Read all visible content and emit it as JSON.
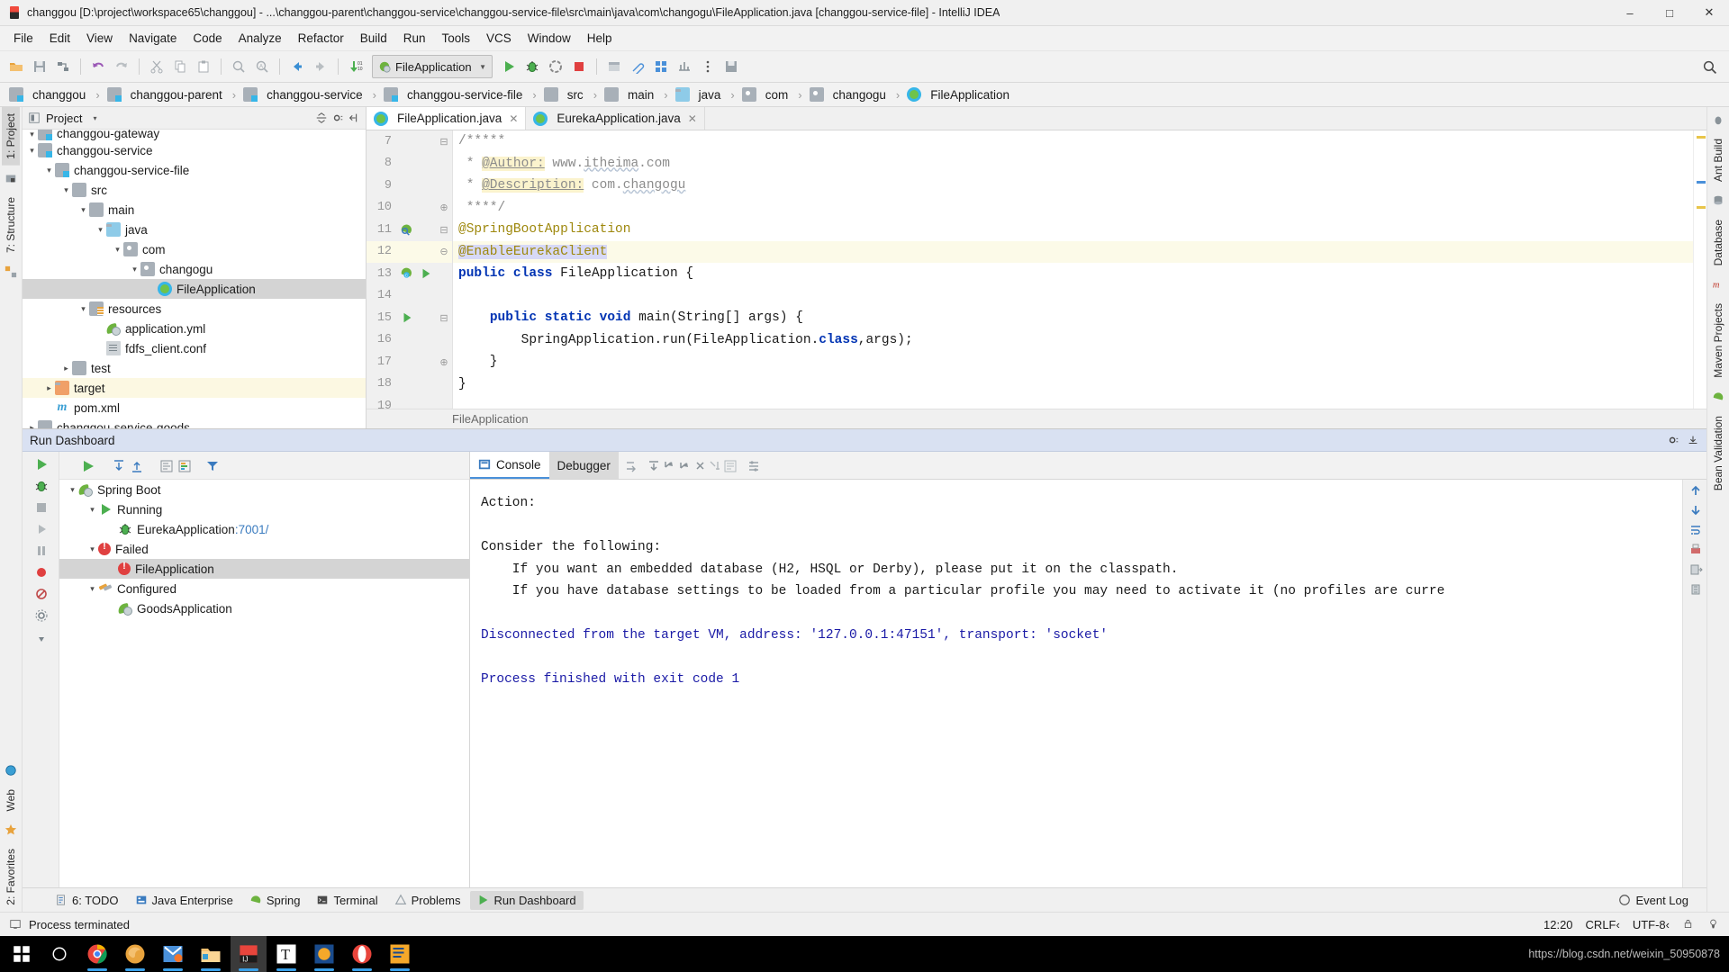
{
  "window": {
    "title": "changgou [D:\\project\\workspace65\\changgou] - ...\\changgou-parent\\changgou-service\\changgou-service-file\\src\\main\\java\\com\\changogu\\FileApplication.java [changgou-service-file] - IntelliJ IDEA",
    "app_icon": "intellij-idea-icon",
    "minimize": "–",
    "maximize": "□",
    "close": "✕"
  },
  "menu": [
    {
      "label": "File"
    },
    {
      "label": "Edit"
    },
    {
      "label": "View"
    },
    {
      "label": "Navigate"
    },
    {
      "label": "Code"
    },
    {
      "label": "Analyze"
    },
    {
      "label": "Refactor"
    },
    {
      "label": "Build"
    },
    {
      "label": "Run"
    },
    {
      "label": "Tools"
    },
    {
      "label": "VCS"
    },
    {
      "label": "Window"
    },
    {
      "label": "Help"
    }
  ],
  "toolbar": {
    "run_config": "FileApplication",
    "icons": [
      "open-folder-icon",
      "save-all-icon",
      "sync-icon",
      "undo-icon",
      "redo-icon",
      "cut-icon",
      "copy-icon",
      "paste-icon",
      "find-icon",
      "replace-icon",
      "back-icon",
      "forward-icon",
      "compile-icon"
    ],
    "right_icons": [
      "run-icon",
      "debug-icon",
      "coverage-icon",
      "stop-icon",
      "build-project-icon",
      "attach-icon",
      "layout-icon",
      "profiler-icon",
      "more-icon",
      "save-icon"
    ],
    "search_icon": "search-everywhere-icon"
  },
  "breadcrumbs": [
    {
      "label": "changgou",
      "icon": "module-icon"
    },
    {
      "label": "changgou-parent",
      "icon": "module-icon"
    },
    {
      "label": "changgou-service",
      "icon": "module-icon"
    },
    {
      "label": "changgou-service-file",
      "icon": "module-icon"
    },
    {
      "label": "src",
      "icon": "folder-icon"
    },
    {
      "label": "main",
      "icon": "folder-icon"
    },
    {
      "label": "java",
      "icon": "source-folder-icon"
    },
    {
      "label": "com",
      "icon": "package-icon"
    },
    {
      "label": "changogu",
      "icon": "package-icon"
    },
    {
      "label": "FileApplication",
      "icon": "class-icon"
    }
  ],
  "left_strip": [
    {
      "label": "1: Project",
      "active": true
    },
    {
      "label": "7: Structure",
      "active": false
    }
  ],
  "left_strip_bottom": [
    {
      "label": "2: Favorites"
    },
    {
      "label": "Web"
    }
  ],
  "right_strip": [
    {
      "label": "Ant Build"
    },
    {
      "label": "Database"
    },
    {
      "label": "Maven Projects"
    },
    {
      "label": "Bean Validation"
    }
  ],
  "project_panel": {
    "title": "Project",
    "caret": "▾",
    "actions": [
      "collapse-all-icon",
      "settings-icon",
      "hide-icon"
    ],
    "tree": [
      {
        "label": "changgou-gateway",
        "depth": 3,
        "twist": "⌄",
        "icon": "module-icon",
        "state": "clipped"
      },
      {
        "label": "changgou-service",
        "depth": 3,
        "twist": "⌄",
        "icon": "module-icon"
      },
      {
        "label": "changgou-service-file",
        "depth": 4,
        "twist": "⌄",
        "icon": "module-icon"
      },
      {
        "label": "src",
        "depth": 5,
        "twist": "⌄",
        "icon": "folder-icon"
      },
      {
        "label": "main",
        "depth": 6,
        "twist": "⌄",
        "icon": "folder-icon"
      },
      {
        "label": "java",
        "depth": 7,
        "twist": "⌄",
        "icon": "source-folder-icon"
      },
      {
        "label": "com",
        "depth": 8,
        "twist": "⌄",
        "icon": "package-icon"
      },
      {
        "label": "changogu",
        "depth": 9,
        "twist": "⌄",
        "icon": "package-icon"
      },
      {
        "label": "FileApplication",
        "depth": 10,
        "twist": "",
        "icon": "class-run-icon",
        "selected": true
      },
      {
        "label": "resources",
        "depth": 6,
        "twist": "⌄",
        "icon": "resources-folder-icon"
      },
      {
        "label": "application.yml",
        "depth": 7,
        "twist": "",
        "icon": "spring-yaml-icon"
      },
      {
        "label": "fdfs_client.conf",
        "depth": 7,
        "twist": "",
        "icon": "conf-file-icon"
      },
      {
        "label": "test",
        "depth": 5,
        "twist": "›",
        "icon": "folder-icon"
      },
      {
        "label": "target",
        "depth": 4,
        "twist": "›",
        "icon": "excluded-folder-icon",
        "highlight": true
      },
      {
        "label": "pom.xml",
        "depth": 4,
        "twist": "",
        "icon": "maven-icon"
      },
      {
        "label": "changgou-service-goods",
        "depth": 3,
        "twist": "›",
        "icon": "module-icon"
      }
    ]
  },
  "editor": {
    "tabs": [
      {
        "label": "FileApplication.java",
        "icon": "class-run-icon",
        "active": true,
        "close": "✕"
      },
      {
        "label": "EurekaApplication.java",
        "icon": "class-run-icon",
        "active": false,
        "close": "✕"
      }
    ],
    "breadcrumb": "FileApplication",
    "lines": [
      {
        "num": 7,
        "gutter": "",
        "fold": "⊟",
        "html": "<span class='cm'>/*****</span>"
      },
      {
        "num": 8,
        "gutter": "",
        "fold": "",
        "html": "<span class='cm'> * </span><span class='cm hl-y tag-underline'>@Author:</span><span class='cm'> www.</span><span class='cm wavy'>itheima</span><span class='cm'>.com</span>"
      },
      {
        "num": 9,
        "gutter": "",
        "fold": "",
        "html": "<span class='cm'> * </span><span class='cm hl-y tag-underline'>@Description:</span><span class='cm'> com.</span><span class='cm wavy'>changogu</span>"
      },
      {
        "num": 10,
        "gutter": "",
        "fold": "⊕",
        "html": "<span class='cm'> ****/</span>"
      },
      {
        "num": 11,
        "gutter": "spring-bean-icon",
        "fold": "⊟",
        "html": "<span class='anno'>@SpringBootApplication</span>"
      },
      {
        "num": 12,
        "gutter": "",
        "fold": "⊖",
        "current": true,
        "html": "<span class='anno hl-b'>@EnableEurekaClient</span>"
      },
      {
        "num": 13,
        "gutter": "spring-class-icon,run-gutter-icon",
        "fold": "",
        "html": "<span class='kw'>public</span> <span class='kw'>class</span> FileApplication {"
      },
      {
        "num": 14,
        "gutter": "",
        "fold": "",
        "html": ""
      },
      {
        "num": 15,
        "gutter": "run-gutter-icon",
        "fold": "⊟",
        "html": "    <span class='kw'>public</span> <span class='kw'>static</span> <span class='kw'>void</span> main(String[] args) {"
      },
      {
        "num": 16,
        "gutter": "",
        "fold": "",
        "html": "        SpringApplication.run(FileApplication.<span class='kw'>class</span>,args);"
      },
      {
        "num": 17,
        "gutter": "",
        "fold": "⊕",
        "html": "    }"
      },
      {
        "num": 18,
        "gutter": "",
        "fold": "",
        "html": "}"
      },
      {
        "num": 19,
        "gutter": "",
        "fold": "",
        "html": ""
      }
    ]
  },
  "run_dashboard": {
    "title": "Run Dashboard",
    "title_actions": [
      "settings-icon",
      "hide-icon"
    ],
    "left_toolbar_icons": [
      "run-icon",
      "expand-all-icon",
      "collapse-all-icon",
      "show-console-icon",
      "show-output-icon",
      "filter-icon"
    ],
    "side_icons": [
      "rerun-icon",
      "debug-icon",
      "stop-icon",
      "resume-icon",
      "pause-icon",
      "breakpoints-icon",
      "mute-breakpoints-icon",
      "settings-icon",
      "pin-icon"
    ],
    "tree": [
      {
        "label": "Spring Boot",
        "depth": 1,
        "twist": "⌄",
        "icon": "spring-icon"
      },
      {
        "label": "Running",
        "depth": 2,
        "twist": "⌄",
        "icon": "run-icon"
      },
      {
        "label": "EurekaApplication",
        "suffix": ":7001/",
        "depth": 3,
        "twist": "",
        "icon": "debug-icon"
      },
      {
        "label": "Failed",
        "depth": 2,
        "twist": "⌄",
        "icon": "error-icon"
      },
      {
        "label": "FileApplication",
        "depth": 3,
        "twist": "",
        "icon": "error-icon",
        "selected": true
      },
      {
        "label": "Configured",
        "depth": 2,
        "twist": "⌄",
        "icon": "wrench-icon"
      },
      {
        "label": "GoodsApplication",
        "depth": 3,
        "twist": "",
        "icon": "spring-icon"
      }
    ],
    "console_tabs": [
      {
        "label": "Console",
        "icon": "console-icon",
        "active": true
      },
      {
        "label": "Debugger",
        "icon": "",
        "active": false
      }
    ],
    "console_tools": [
      "step-over-icon",
      "step-into-icon",
      "force-step-into-icon",
      "step-out-icon",
      "drop-frame-icon",
      "run-to-cursor-icon",
      "evaluate-icon",
      "mute-icon",
      "settings-icon"
    ],
    "console_output": [
      {
        "text": "Action:",
        "color": "black"
      },
      {
        "text": "",
        "color": "black"
      },
      {
        "text": "Consider the following:",
        "color": "black"
      },
      {
        "text": "    If you want an embedded database (H2, HSQL or Derby), please put it on the classpath.",
        "color": "black"
      },
      {
        "text": "    If you have database settings to be loaded from a particular profile you may need to activate it (no profiles are curre",
        "color": "black"
      },
      {
        "text": "",
        "color": "black"
      },
      {
        "text": "Disconnected from the target VM, address: '127.0.0.1:47151', transport: 'socket'",
        "color": "blue"
      },
      {
        "text": "",
        "color": "black"
      },
      {
        "text": "Process finished with exit code 1",
        "color": "blue"
      }
    ],
    "console_side_icons": [
      "scroll-up-icon",
      "scroll-down-icon",
      "soft-wrap-icon",
      "print-icon",
      "export-icon",
      "clear-icon"
    ]
  },
  "tool_window_bar": {
    "items": [
      {
        "label": "6: TODO",
        "icon": "todo-icon",
        "active": false
      },
      {
        "label": "Java Enterprise",
        "icon": "java-enterprise-icon",
        "active": false
      },
      {
        "label": "Spring",
        "icon": "spring-icon",
        "active": false
      },
      {
        "label": "Terminal",
        "icon": "terminal-icon",
        "active": false
      },
      {
        "label": "Problems",
        "icon": "problems-icon",
        "active": false
      },
      {
        "label": "Run Dashboard",
        "icon": "run-dashboard-icon",
        "active": true
      }
    ],
    "event_log": {
      "label": "Event Log",
      "icon": "event-log-icon"
    }
  },
  "status_bar": {
    "message": "Process terminated",
    "message_icon": "terminal-small-icon",
    "time": "12:20",
    "line_sep": "CRLF‹",
    "encoding": "UTF-8‹",
    "lock_icon": "lock-icon",
    "inspection_icon": "inspection-icon"
  },
  "taskbar": {
    "items": [
      {
        "name": "start-button",
        "icon": "windows-logo-icon",
        "running": false
      },
      {
        "name": "cortana-search",
        "icon": "circle-search-icon",
        "running": false
      },
      {
        "name": "chrome",
        "icon": "chrome-icon",
        "running": true
      },
      {
        "name": "firefox",
        "icon": "firefox-icon",
        "running": true
      },
      {
        "name": "postman",
        "icon": "postman-icon",
        "running": true
      },
      {
        "name": "file-explorer",
        "icon": "folder-icon",
        "running": true
      },
      {
        "name": "intellij-idea",
        "icon": "intellij-idea-icon",
        "running": true,
        "active": true
      },
      {
        "name": "typora",
        "icon": "typora-icon",
        "running": true
      },
      {
        "name": "navicat",
        "icon": "navicat-icon",
        "running": true
      },
      {
        "name": "opera",
        "icon": "opera-icon",
        "running": true
      },
      {
        "name": "editplus",
        "icon": "editplus-icon",
        "running": true
      }
    ],
    "watermark": "https://blog.csdn.net/weixin_50950878"
  }
}
